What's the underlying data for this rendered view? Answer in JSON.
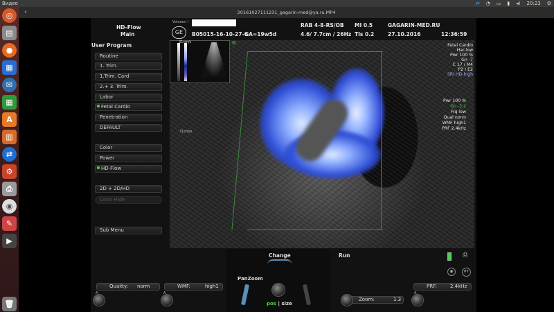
{
  "topbar": {
    "app_title": "Видео",
    "time": "20:23"
  },
  "window": {
    "title": "20161027111231_gagarin-med@ya.ru.MP4"
  },
  "header": {
    "mode_title": "HD-Flow",
    "mode_subtitle": "Main",
    "volume_label": "Volusen !",
    "patient_id": "B05015-16-10-27-6",
    "ga": "GA=19w5d",
    "probe": "RAB 4-8-RS/OB",
    "depth_freq": "4.6/ 7.7cm / 26Hz",
    "mi": "MI  0.5",
    "tis": "TIs  0.2",
    "site": "GAGARIN-MED.RU",
    "date": "27.10.2016",
    "clock": "12:36:59"
  },
  "menu": {
    "title": "User Program",
    "items": [
      {
        "label": "Routine",
        "active": false
      },
      {
        "label": "1. Trim.",
        "active": false
      },
      {
        "label": "1.Trim. Card",
        "active": false
      },
      {
        "label": "2.+ 3. Trim.",
        "active": false
      },
      {
        "label": "Labor",
        "active": false
      },
      {
        "label": "Fetal Cardio",
        "active": true
      },
      {
        "label": "Penetration",
        "active": false
      },
      {
        "label": "DEFAULT",
        "active": false
      }
    ],
    "mode_items": [
      {
        "label": "Color",
        "active": false
      },
      {
        "label": "Power",
        "active": false
      },
      {
        "label": "HD-Flow",
        "active": true
      }
    ],
    "layout_item": "2D + 2D/HD",
    "color_hide": "Color Hide",
    "sub_menu": "Sub Menu"
  },
  "scale": {
    "top_label": "31cm/s",
    "bottom_label": "31cm/s"
  },
  "right_info": {
    "block1": [
      "Fetal Cardio",
      "Har-low",
      "Pwr 100 %",
      "Gn -7",
      "C 17 / M4",
      "P2 / E2",
      "SRI HD-high"
    ],
    "block2": [
      "Pwr 100 %",
      "Gn -3.2",
      "Frq low",
      "Qual norm",
      "WMF high1",
      "PRF 2.4kHz"
    ]
  },
  "bottom": {
    "quality_label": "Quality:",
    "quality_value": "norm",
    "wmf_label": "WMF:",
    "wmf_value": "high1",
    "panzoom": "PanZoom",
    "change": "Change",
    "run": "Run",
    "pos_size_pos": "pos",
    "pos_size_sep": "|",
    "pos_size_size": "size",
    "zoom_label": "Zoom:",
    "zoom_value": "1.3",
    "prf_label": "PRF:",
    "prf_value": "2.4kHz",
    "ap_label": "A",
    "p7_label": "P7"
  }
}
